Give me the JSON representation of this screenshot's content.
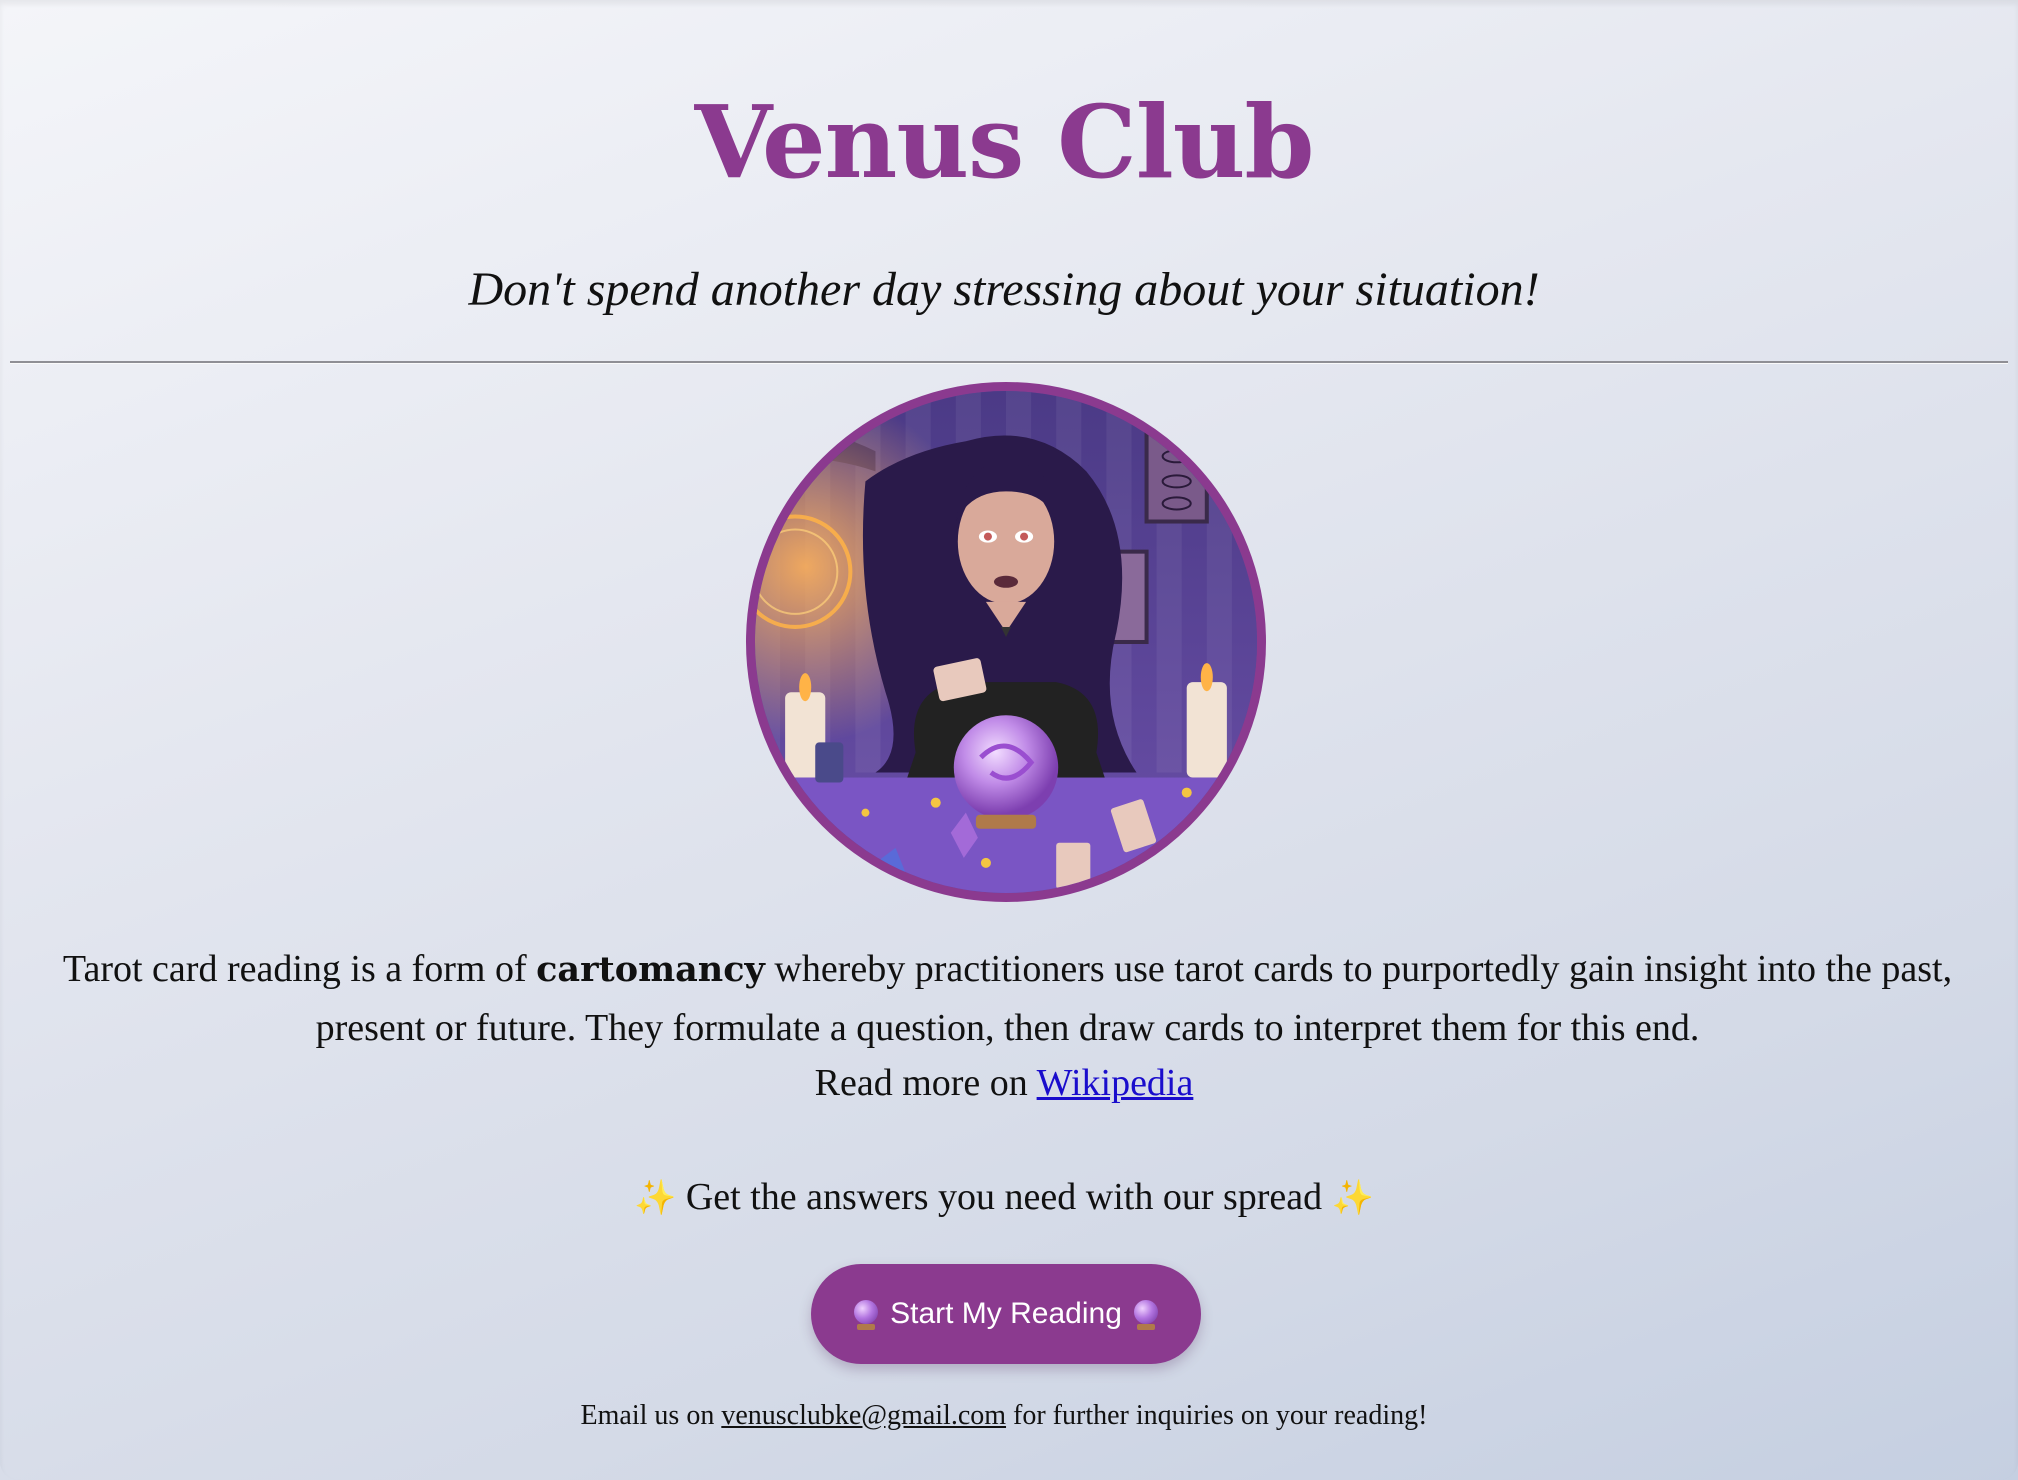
{
  "header": {
    "title": "Venus Club",
    "subtitle": "Don't spend another day stressing about your situation!"
  },
  "hero": {
    "image_subject": "illustrated tarot reader with crystal ball",
    "accent_color": "#8b3a8f"
  },
  "intro": {
    "text_before": "Tarot card reading is a form of ",
    "bold_term": "cartomancy",
    "text_after": " whereby practitioners use tarot cards to purportedly gain insight into the past, present or future. They formulate a question, then draw cards to interpret them for this end.",
    "read_more_prefix": "Read more on ",
    "read_more_link": "Wikipedia"
  },
  "cta": {
    "sparkle_left": "✨",
    "line": " Get the answers you need with our spread ",
    "sparkle_right": "✨",
    "button_label": "Start My Reading",
    "button_icon": "crystal-ball-icon"
  },
  "footer": {
    "prefix": "Email us on ",
    "email": "venusclubke@gmail.com",
    "suffix": " for further inquiries on your reading!"
  }
}
